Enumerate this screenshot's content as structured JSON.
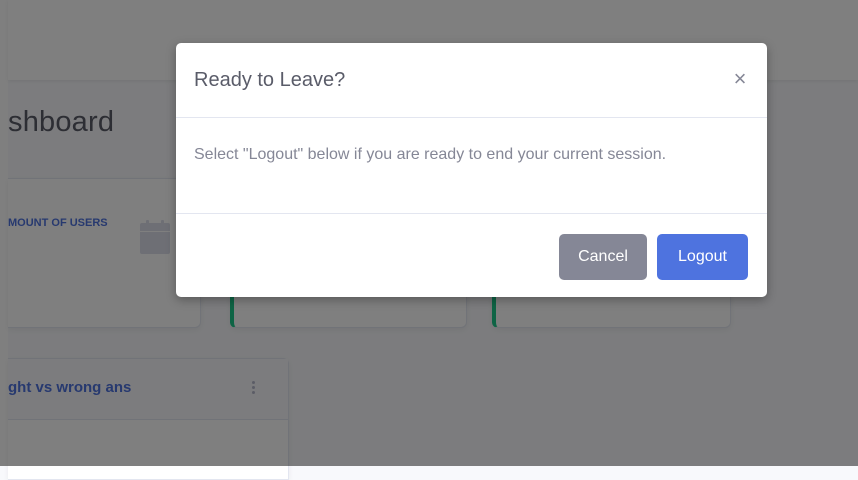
{
  "dashboard": {
    "page_title": "shboard",
    "card1_label": "MOUNT OF USERS",
    "chart_card_title": "ght vs wrong ans"
  },
  "modal": {
    "title": "Ready to Leave?",
    "close_symbol": "×",
    "body_text": "Select \"Logout\" below if you are ready to end your current session.",
    "cancel_label": "Cancel",
    "logout_label": "Logout"
  },
  "colors": {
    "primary": "#4e73df",
    "secondary": "#858796",
    "success": "#1cc88a"
  }
}
